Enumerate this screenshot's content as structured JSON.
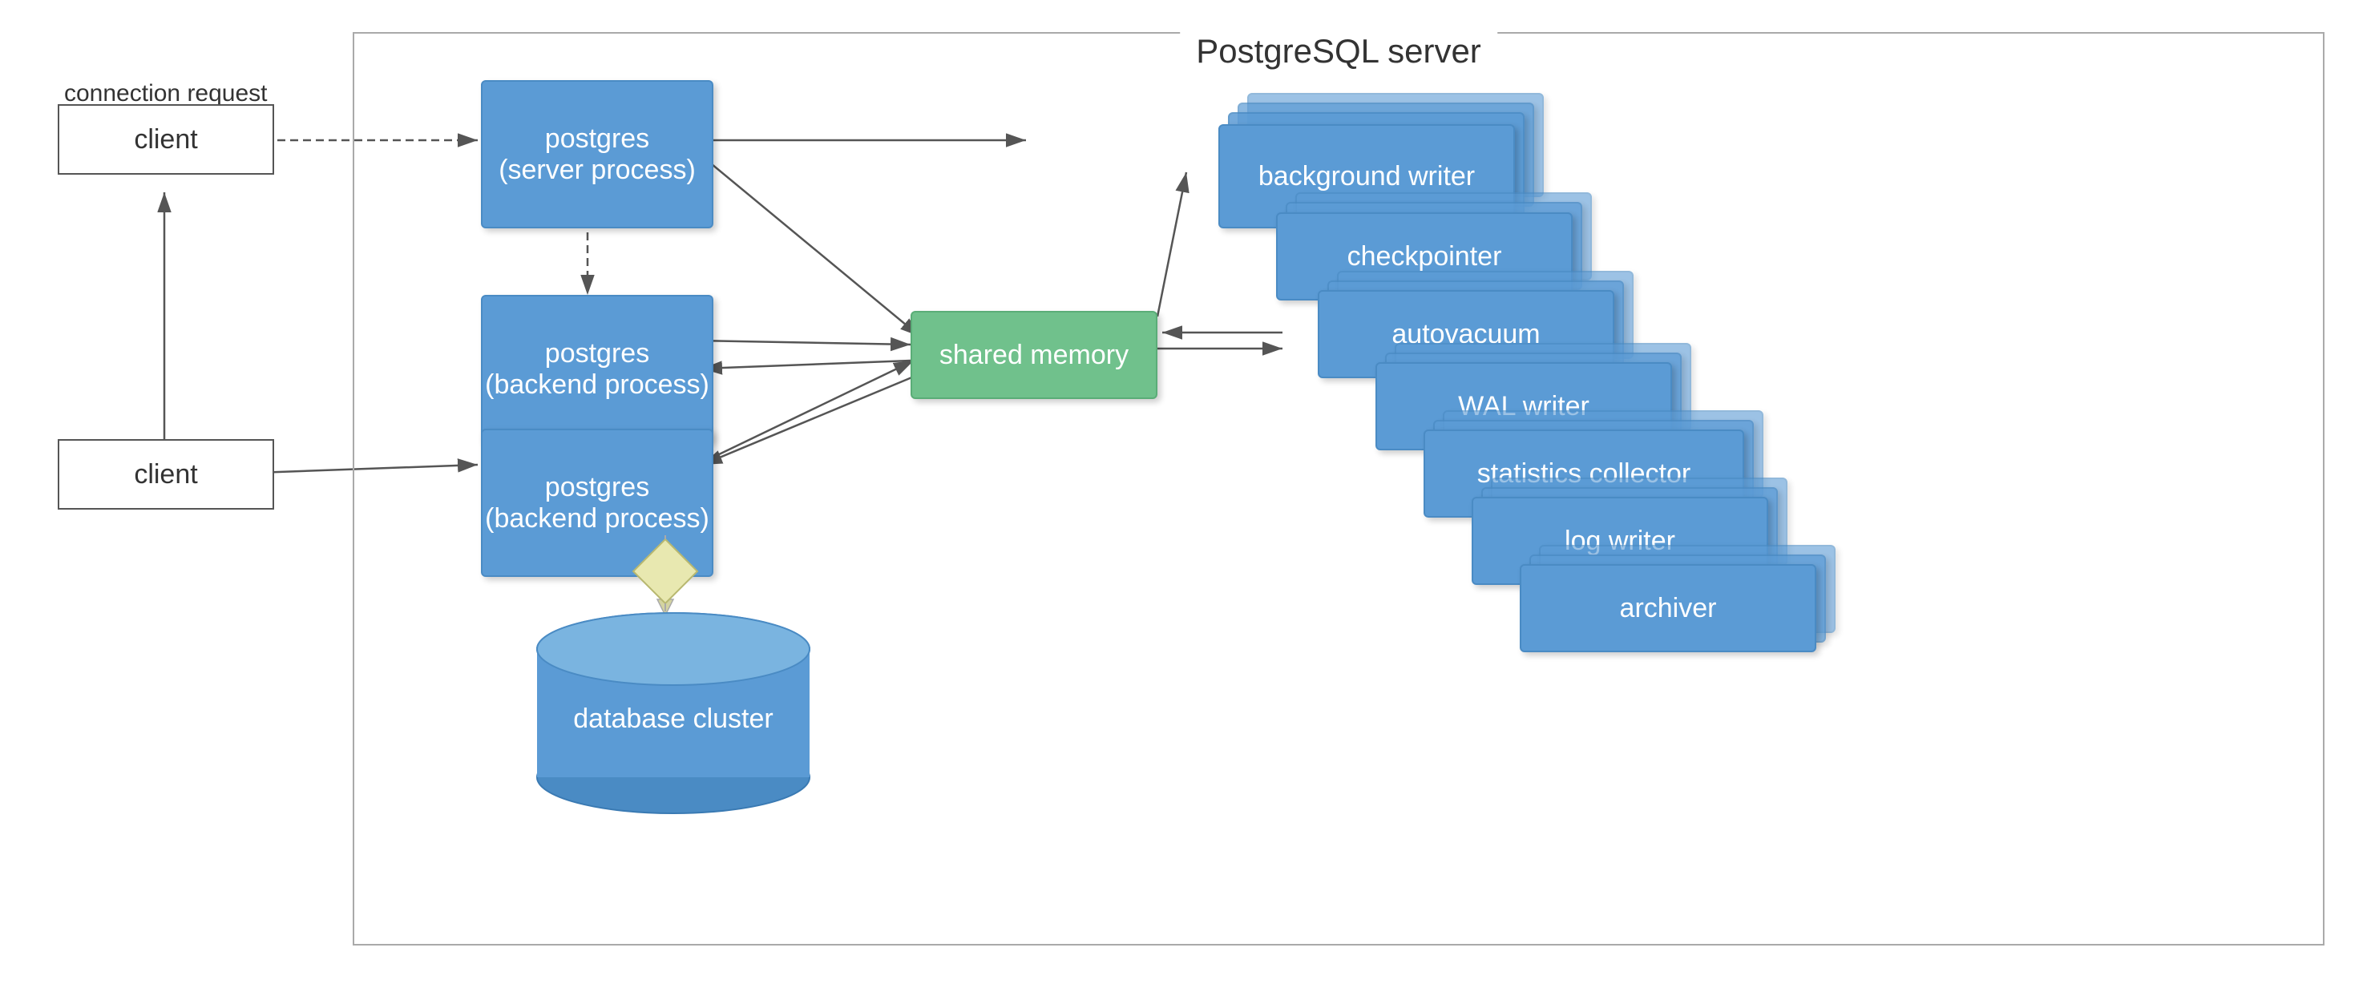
{
  "title": "PostgreSQL server",
  "client_top": {
    "label": "client",
    "connection_request": "connection request"
  },
  "client_bottom": {
    "label": "client"
  },
  "postgres_server": {
    "line1": "postgres",
    "line2": "(server process)"
  },
  "postgres_backend1": {
    "line1": "postgres",
    "line2": "(backend process)"
  },
  "postgres_backend2": {
    "line1": "postgres",
    "line2": "(backend process)"
  },
  "shared_memory": {
    "label": "shared memory"
  },
  "background_writer": {
    "label": "background writer"
  },
  "checkpointer": {
    "label": "checkpointer"
  },
  "autovacuum": {
    "label": "autovacuum"
  },
  "wal_writer": {
    "label": "WAL writer"
  },
  "statistics_collector": {
    "label": "statistics collector"
  },
  "log_writer": {
    "label": "log writer"
  },
  "archiver": {
    "label": "archiver"
  },
  "database_cluster": {
    "label": "database cluster"
  }
}
